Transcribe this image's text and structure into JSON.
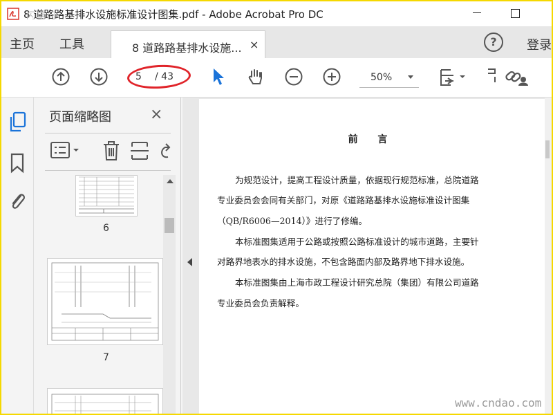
{
  "window": {
    "title": "8 道路路基排水设施标准设计图集.pdf - Adobe Acrobat Pro DC",
    "watermark_top": "闪电问"
  },
  "menu": {
    "home": "主页",
    "tools": "工具",
    "tab_label": "8 道路路基排水设施...",
    "tab_close": "×",
    "help": "?",
    "login": "登录"
  },
  "toolbar": {
    "current_page": "5",
    "total_pages": "/ 43",
    "zoom": "50%",
    "icons": [
      "prev-page-icon",
      "next-page-icon",
      "select-arrow-icon",
      "hand-tool-icon",
      "zoom-out-icon",
      "zoom-in-icon",
      "fit-page-icon",
      "comment-icon",
      "link-icon",
      "share-icon"
    ]
  },
  "colors": {
    "highlight": "#e0242a",
    "frame": "#f5d800",
    "accent": "#1a73d9"
  },
  "sidebar": {
    "title": "页面缩略图",
    "close": "×",
    "thumbnails": [
      {
        "label": "6"
      },
      {
        "label": "7"
      }
    ]
  },
  "document": {
    "heading": "前 言",
    "lines": [
      "为规范设计，提高工程设计质量，依据现行规范标准，总院道路",
      "专业委员会会同有关部门，对原《道路路基排水设施标准设计图集",
      "（QB/R6006—2014）》进行了修编。",
      "本标准图集适用于公路或按照公路标准设计的城市道路，主要针",
      "对路界地表水的排水设施，不包含路面内部及路界地下排水设施。",
      "本标准图集由上海市政工程设计研究总院（集团）有限公司道路",
      "专业委员会负责解释。"
    ]
  },
  "site_watermark": "www.cndao.com"
}
